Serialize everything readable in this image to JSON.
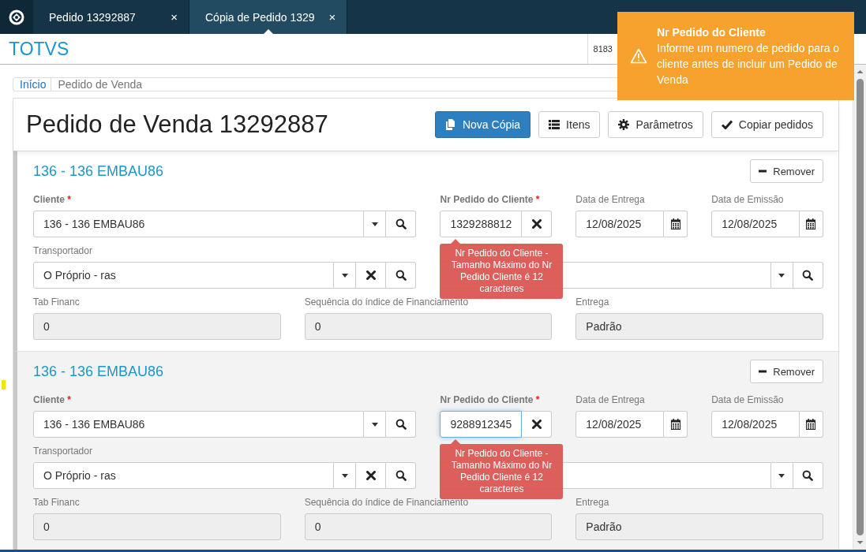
{
  "navbar": {
    "tabs": [
      {
        "label": "Pedido 13292887",
        "close": "×",
        "selected": false
      },
      {
        "label": "Cópia de Pedido 1329",
        "close": "×",
        "selected": true
      }
    ]
  },
  "header": {
    "brand": "TOTVS",
    "user_code": "8183"
  },
  "toast": {
    "title": "Nr Pedido do Cliente",
    "message": "Informe um numero de pedido para o cliente antes de incluir um Pedido de Venda"
  },
  "breadcrumb": [
    {
      "label": "Início",
      "kind": "link"
    },
    {
      "label": "Pedido de Venda",
      "kind": "current"
    }
  ],
  "page": {
    "title": "Pedido de Venda 13292887",
    "buttons": [
      {
        "label": "Nova Cópia",
        "kind": "copy",
        "primary": true
      },
      {
        "label": "Itens",
        "kind": "list",
        "primary": false
      },
      {
        "label": "Parâmetros",
        "kind": "settings",
        "primary": false
      },
      {
        "label": "Copiar pedidos",
        "kind": "confirm",
        "primary": false
      }
    ]
  },
  "orders": [
    {
      "heading": "136 - 136 EMBAU86",
      "remove_label": "Remover",
      "highlighted": false,
      "fields": [
        {
          "label": "Cliente",
          "required_mark": "*",
          "kind": "select-search",
          "value": "136 - 136 EMBAU86"
        },
        {
          "label": "Nr Pedido do Cliente",
          "required_mark": "*",
          "kind": "input-clear",
          "value": "1329288812",
          "focused": false,
          "error": "Nr Pedido do Cliente - Tamanho Máximo do Nr Pedido Cliente é 12 caracteres"
        },
        {
          "label": "Data de Entrega",
          "kind": "date",
          "value": "12/08/2025"
        },
        {
          "label": "Data de Emissão",
          "kind": "date",
          "value": "12/08/2025"
        },
        {
          "label": "Transportador",
          "kind": "select-clear-search",
          "value": "O Próprio - ras"
        },
        {
          "kind": "select-search"
        },
        {
          "label": "Tab Financ",
          "kind": "readonly",
          "value": "0"
        },
        {
          "label": "Sequência do índice de Financiamento",
          "kind": "readonly",
          "value": "0"
        },
        {
          "label": "Entrega",
          "kind": "readonly",
          "value": "Padrão"
        }
      ]
    },
    {
      "heading": "136 - 136 EMBAU86",
      "remove_label": "Remover",
      "highlighted": true,
      "fields": [
        {
          "label": "Cliente",
          "required_mark": "*",
          "kind": "select-search",
          "value": "136 - 136 EMBAU86"
        },
        {
          "label": "Nr Pedido do Cliente",
          "required_mark": "*",
          "kind": "input-clear",
          "value": "9288912345",
          "focused": true,
          "error": "Nr Pedido do Cliente - Tamanho Máximo do Nr Pedido Cliente é 12 caracteres"
        },
        {
          "label": "Data de Entrega",
          "kind": "date",
          "value": "12/08/2025"
        },
        {
          "label": "Data de Emissão",
          "kind": "date",
          "value": "12/08/2025"
        },
        {
          "label": "Transportador",
          "kind": "select-clear-search",
          "value": "O Próprio - ras"
        },
        {
          "kind": "select-search"
        },
        {
          "label": "Tab Financ",
          "kind": "readonly",
          "value": "0"
        },
        {
          "label": "Sequência do índice de Financiamento",
          "kind": "readonly",
          "value": "0"
        },
        {
          "label": "Entrega",
          "kind": "readonly",
          "value": "Padrão"
        }
      ]
    }
  ]
}
